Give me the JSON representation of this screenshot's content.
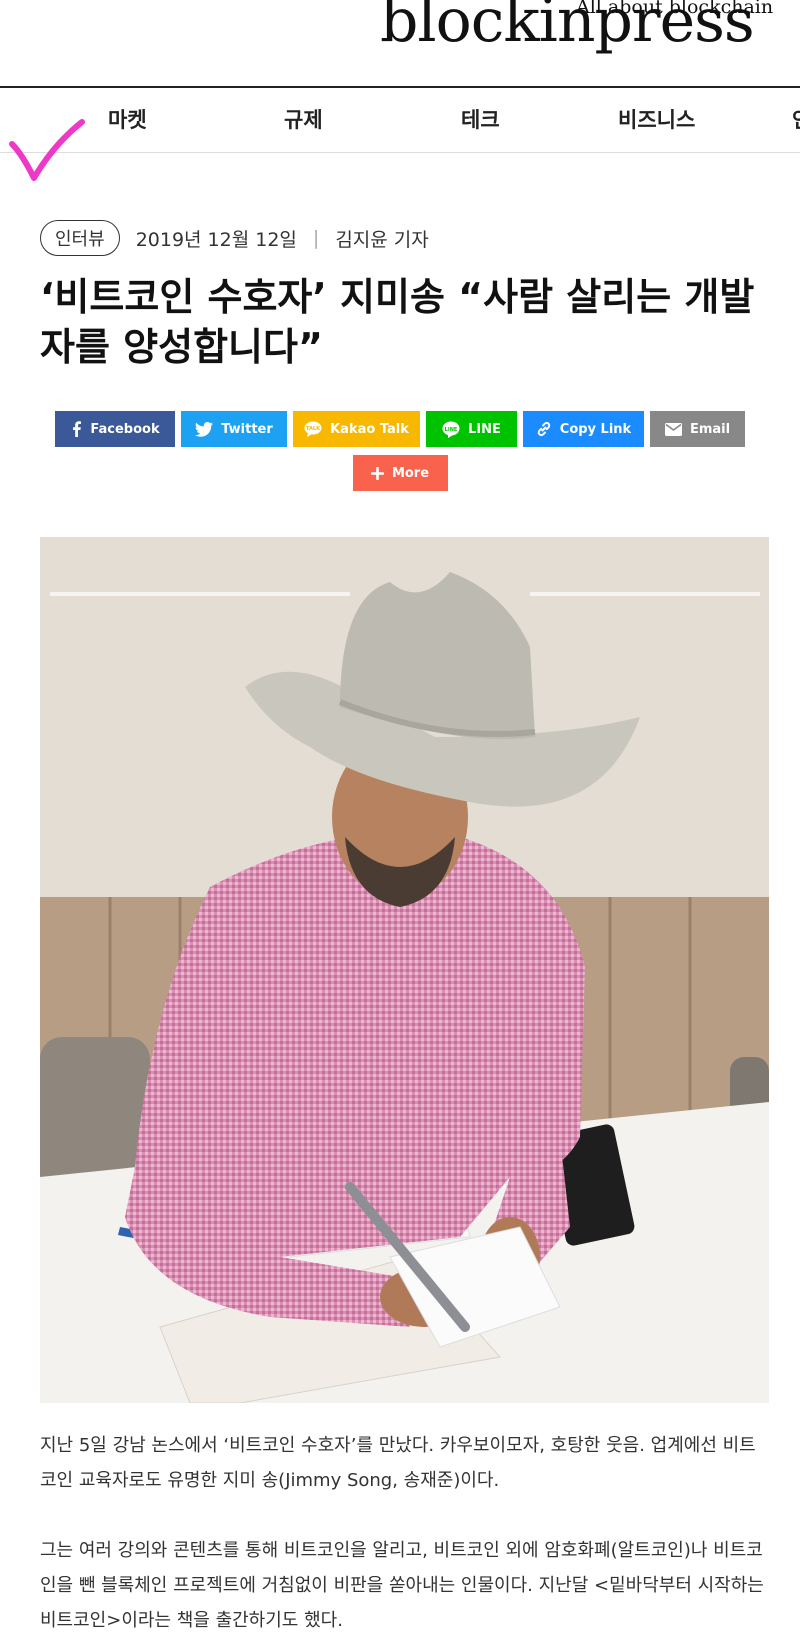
{
  "site": {
    "logo": "blockinpress",
    "tagline": "All about blockchain"
  },
  "nav": {
    "items": [
      {
        "label": "마켓"
      },
      {
        "label": "규제"
      },
      {
        "label": "테크"
      },
      {
        "label": "비즈니스"
      },
      {
        "label": "인"
      }
    ]
  },
  "article": {
    "category": "인터뷰",
    "date": "2019년 12월 12일",
    "author": "김지윤 기자",
    "title": "‘비트코인 수호자’ 지미송 “사람 살리는 개발자를 양성합니다”",
    "paragraphs": [
      "지난 5일 강남 논스에서 ‘비트코인 수호자’를 만났다. 카우보이모자, 호탕한 웃음. 업계에선 비트코인 교육자로도 유명한 지미 송(Jimmy Song, 송재준)이다.",
      "그는 여러 강의와 콘텐츠를 통해 비트코인을 알리고, 비트코인 외에 암호화폐(알트코인)나 비트코인을 뺀 블록체인 프로젝트에 거침없이 비판을 쏟아내는 인물이다. 지난달 <밑바닥부터 시작하는 비트코인>이라는 책을 출간하기도 했다."
    ]
  },
  "share": {
    "buttons": [
      {
        "label": "Facebook",
        "color": "#3b5998",
        "icon": "facebook-icon"
      },
      {
        "label": "Twitter",
        "color": "#1da1f2",
        "icon": "twitter-icon"
      },
      {
        "label": "Kakao Talk",
        "color": "#f9b800",
        "icon": "kakao-talk-icon"
      },
      {
        "label": "LINE",
        "color": "#00c300",
        "icon": "line-icon"
      },
      {
        "label": "Copy Link",
        "color": "#1a8cff",
        "icon": "link-icon"
      },
      {
        "label": "Email",
        "color": "#888888",
        "icon": "email-icon"
      },
      {
        "label": "More",
        "color": "#f9634d",
        "icon": "plus-icon"
      }
    ]
  },
  "colors": {
    "check_mark": "#ee38c8"
  }
}
